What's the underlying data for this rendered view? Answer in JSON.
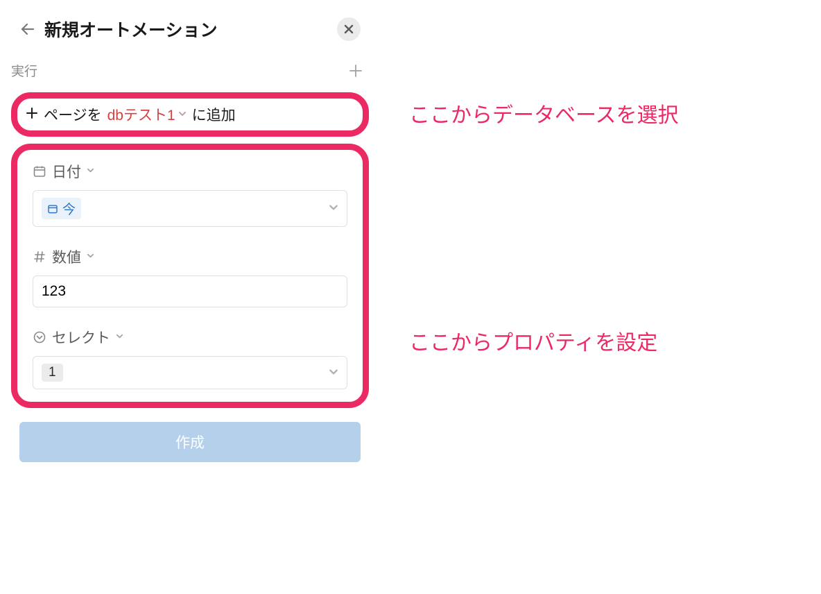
{
  "header": {
    "title": "新規オートメーション"
  },
  "section_label": "実行",
  "db_row": {
    "prefix": "ページを",
    "db_name": "dbテスト1",
    "suffix": "に追加"
  },
  "props": {
    "date": {
      "label": "日付",
      "chip_text": "今"
    },
    "number": {
      "label": "数値",
      "value": "123"
    },
    "select": {
      "label": "セレクト",
      "chip_text": "1"
    }
  },
  "create_button": "作成",
  "annotations": {
    "a1": "ここからデータベースを選択",
    "a2": "ここからプロパティを設定"
  }
}
